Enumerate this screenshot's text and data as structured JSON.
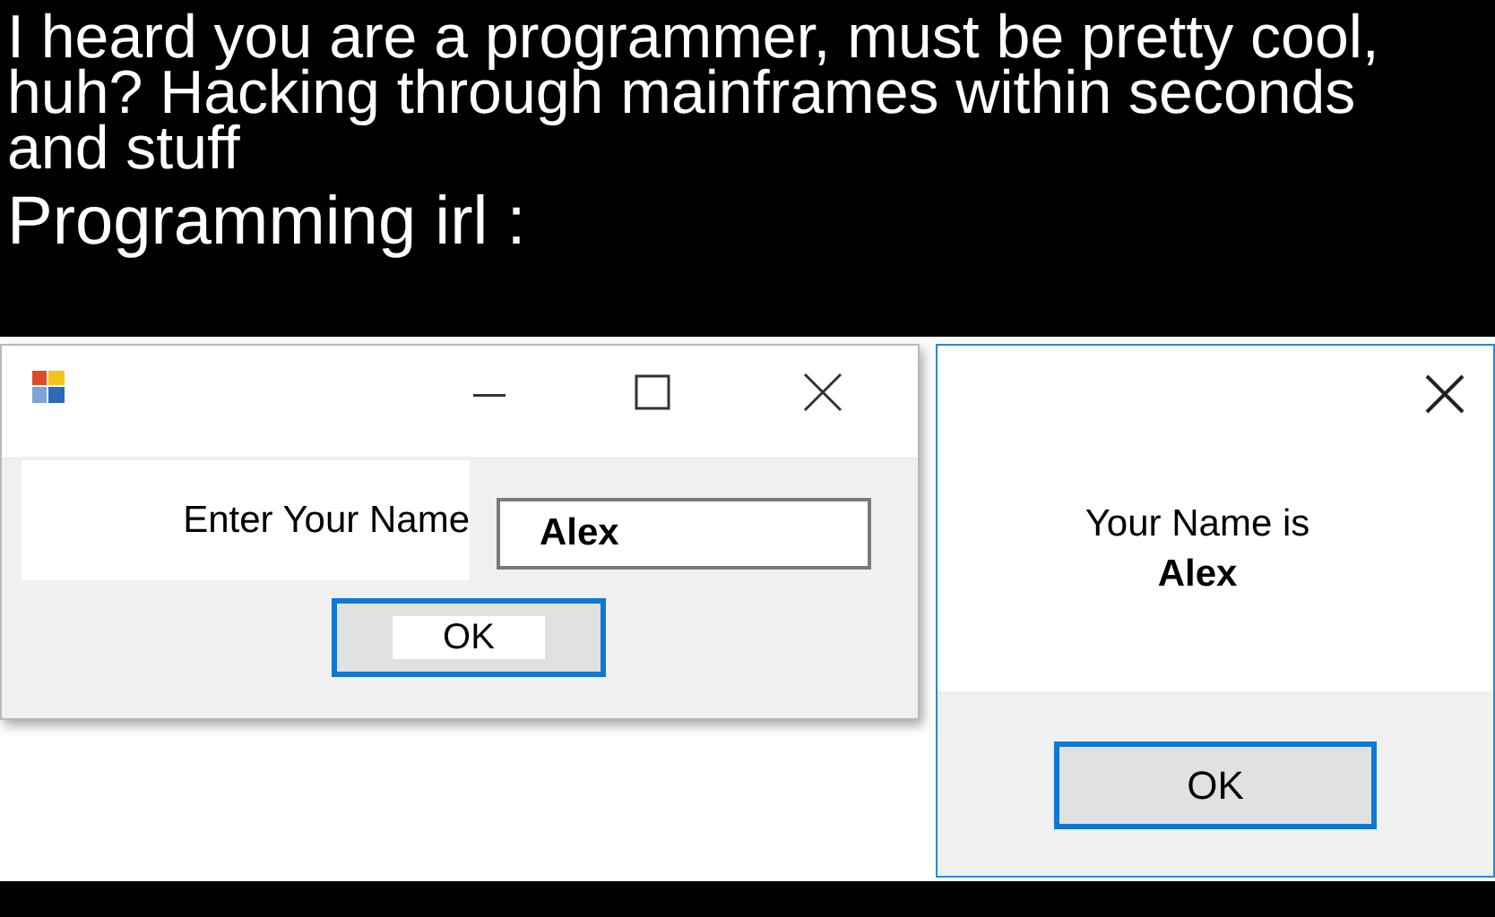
{
  "caption": {
    "lines": [
      "I heard you are a programmer, must be pretty cool, huh? Hacking through mainframes within seconds and stuff",
      "Programming irl :"
    ]
  },
  "input_dialog": {
    "prompt": "Enter Your Name",
    "value": "Alex",
    "button": "OK"
  },
  "message_dialog": {
    "message": "Your Name is",
    "name": "Alex",
    "button": "OK"
  }
}
